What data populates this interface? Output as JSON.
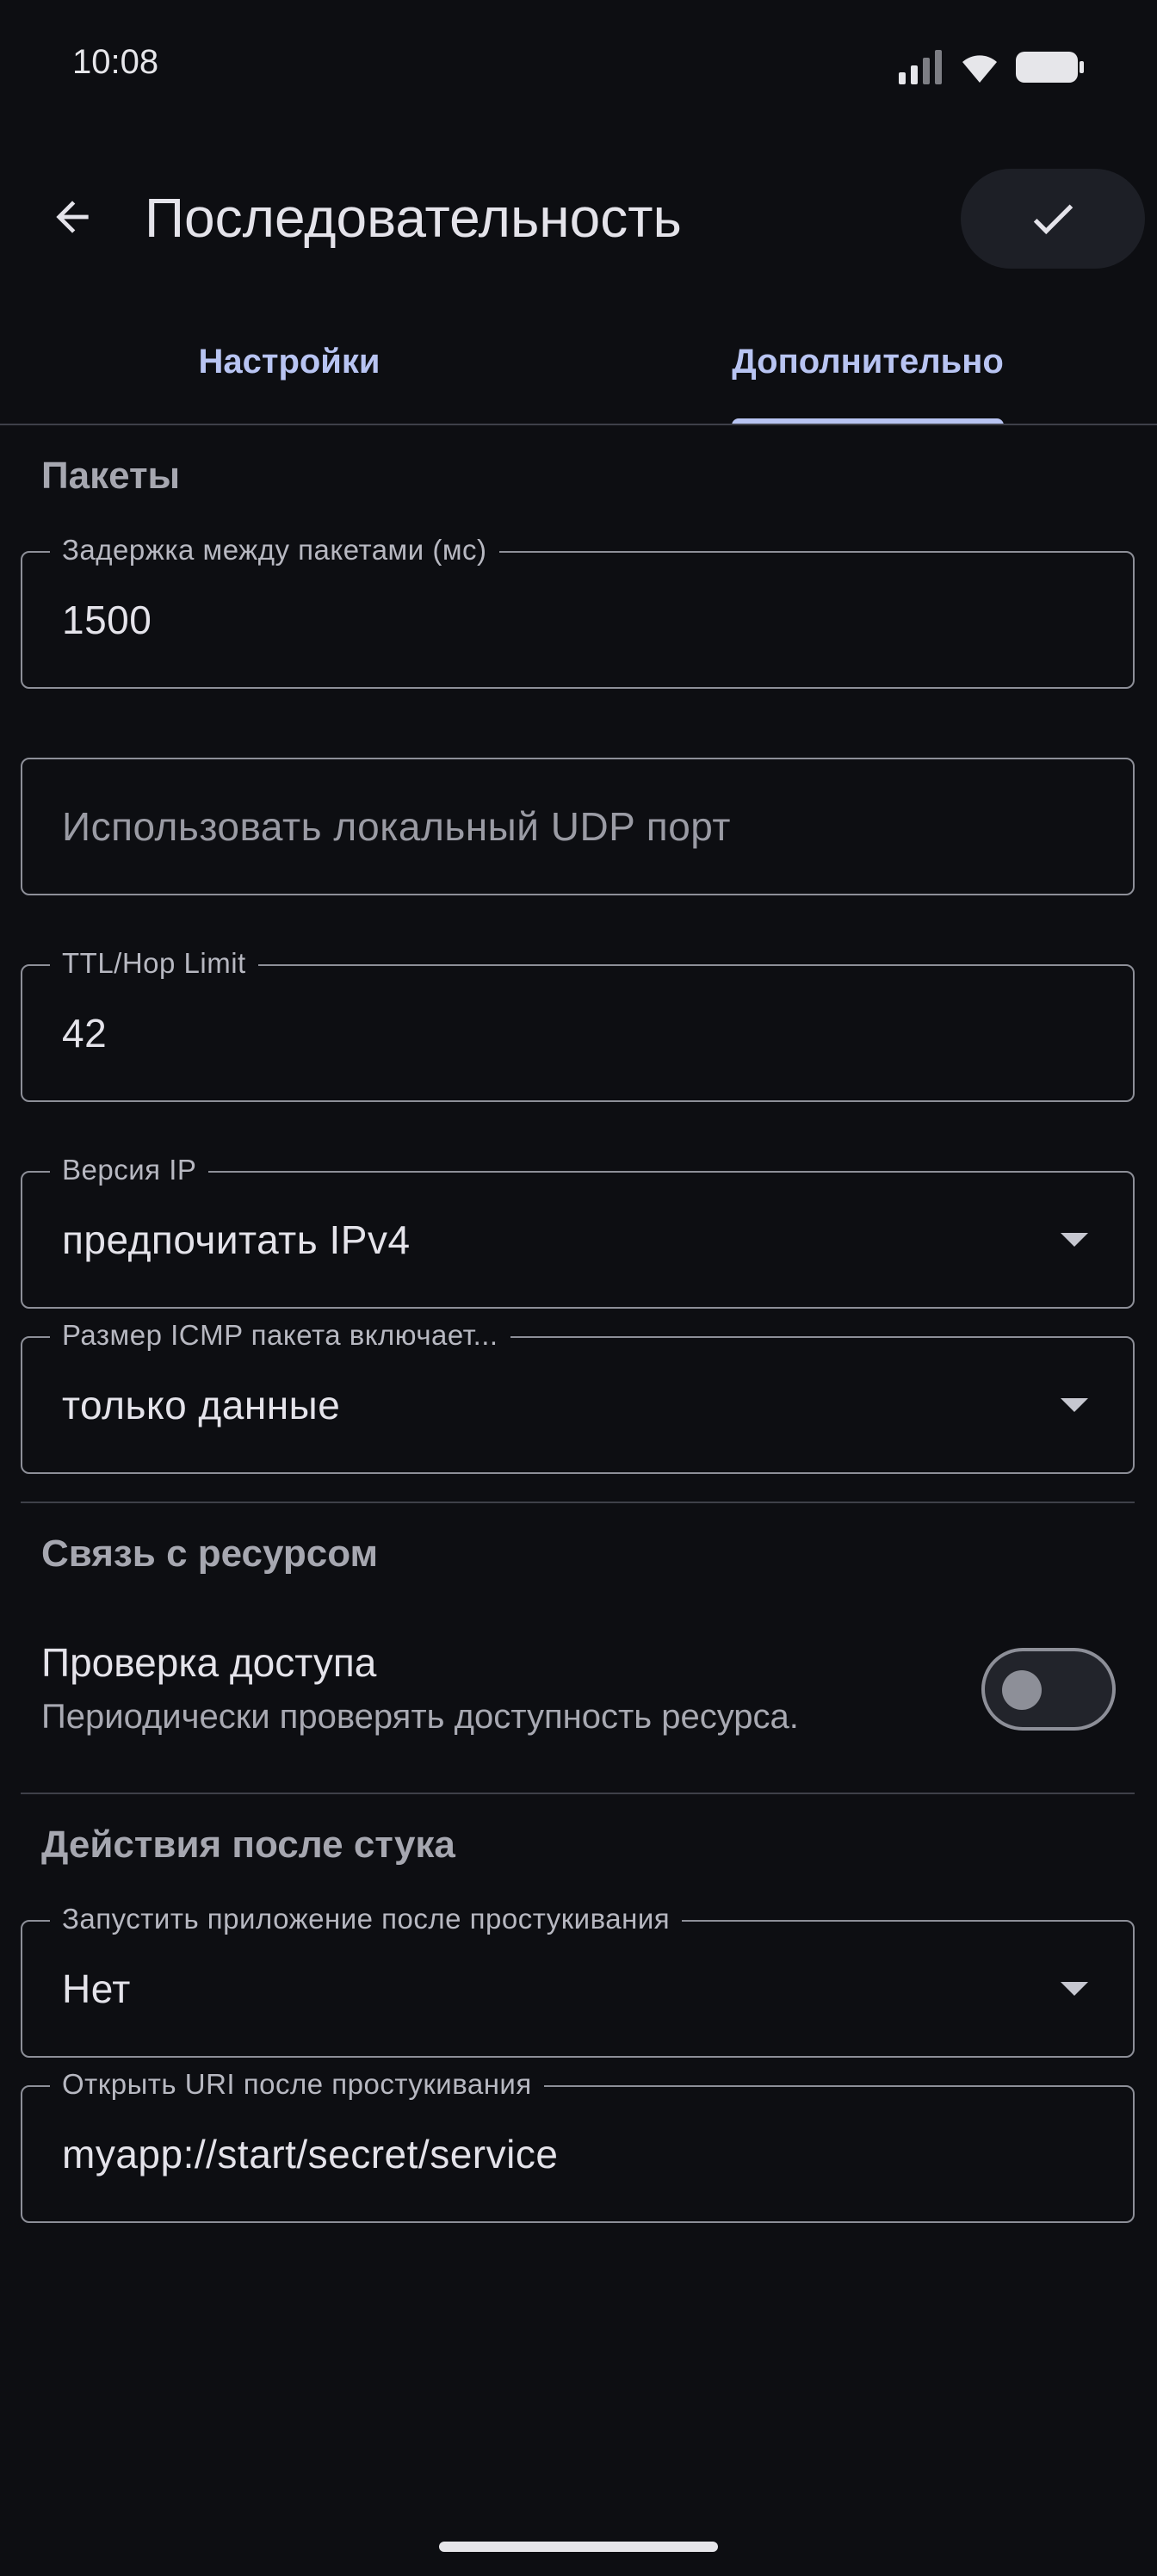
{
  "status_bar": {
    "time": "10:08",
    "icons": [
      "signal-icon",
      "wifi-icon",
      "battery-icon"
    ]
  },
  "app_bar": {
    "back_icon": "arrow-left-icon",
    "title": "Последовательность",
    "confirm_icon": "check-icon"
  },
  "tabs": [
    {
      "label": "Настройки",
      "selected": false
    },
    {
      "label": "Дополнительно",
      "selected": true
    }
  ],
  "sections": {
    "packets": {
      "header": "Пакеты",
      "delay_field": {
        "label": "Задержка между пакетами (мс)",
        "value": "1500"
      },
      "udp_port_field": {
        "placeholder": "Использовать локальный UDP порт",
        "value": ""
      },
      "ttl_field": {
        "label": "TTL/Hop Limit",
        "value": "42"
      },
      "ip_version_field": {
        "label": "Версия IP",
        "value": "предпочитать IPv4"
      },
      "icmp_size_field": {
        "label": "Размер ICMP пакета включает...",
        "value": "только данные"
      }
    },
    "resource": {
      "header": "Связь с ресурсом",
      "access_check": {
        "title": "Проверка доступа",
        "description": "Периодически проверять доступность ресурса.",
        "enabled": false
      }
    },
    "after_knock": {
      "header": "Действия после стука",
      "launch_app_field": {
        "label": "Запустить приложение после простукивания",
        "value": "Нет"
      },
      "open_uri_field": {
        "label": "Открыть URI после простукивания",
        "value": "myapp://start/secret/service"
      }
    }
  },
  "colors": {
    "background": "#0d0e12",
    "accent": "#b8c4f2",
    "outline": "#8d8f98",
    "text_primary": "#e4e3ea",
    "text_secondary": "#a8a9b2"
  }
}
